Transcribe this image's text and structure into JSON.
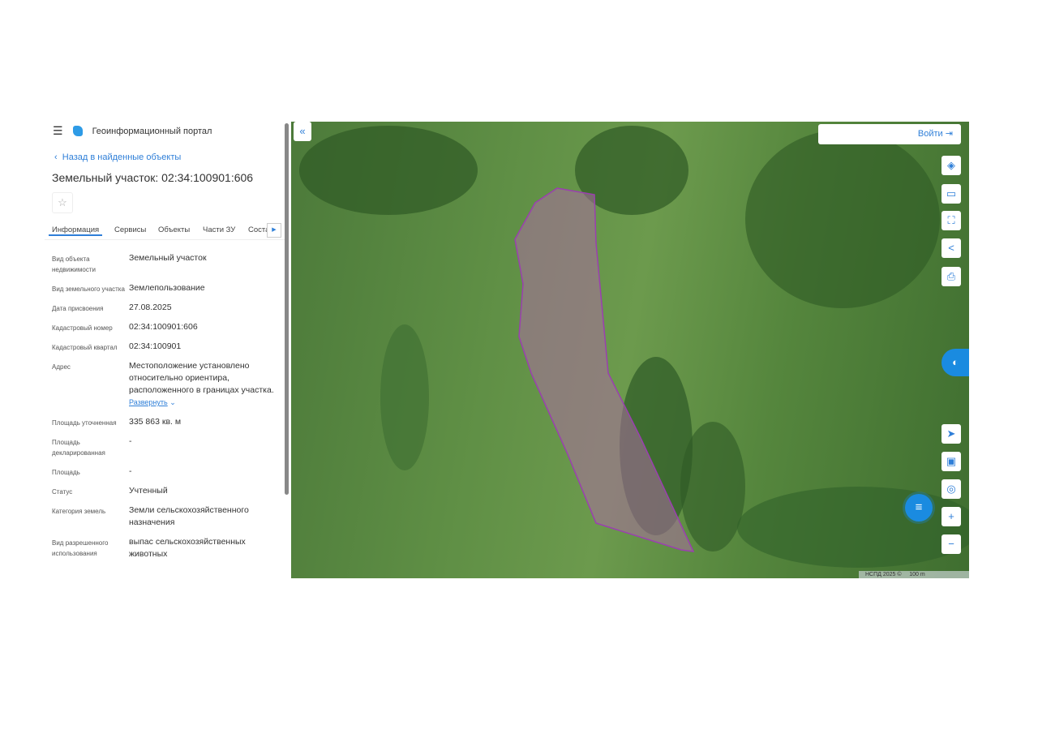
{
  "header": {
    "app_title": "Геоинформационный портал",
    "back_link": "Назад в найденные объекты",
    "object_title": "Земельный участок: 02:34:100901:606"
  },
  "tabs": [
    "Информация",
    "Сервисы",
    "Объекты",
    "Части ЗУ",
    "Соста"
  ],
  "fields": [
    {
      "label": "Вид объекта недвижимости",
      "value": "Земельный участок"
    },
    {
      "label": "Вид земельного участка",
      "value": "Землепользование"
    },
    {
      "label": "Дата присвоения",
      "value": "27.08.2025"
    },
    {
      "label": "Кадастровый номер",
      "value": "02:34:100901:606"
    },
    {
      "label": "Кадастровый квартал",
      "value": "02:34:100901"
    },
    {
      "label": "Адрес",
      "value": "Местоположение установлено относительно ориентира, расположенного в границах участка.",
      "link": "Развернуть"
    },
    {
      "label": "Площадь уточненная",
      "value": "335 863 кв. м"
    },
    {
      "label": "Площадь декларированная",
      "value": "-"
    },
    {
      "label": "Площадь",
      "value": "-"
    },
    {
      "label": "Статус",
      "value": "Учтенный"
    },
    {
      "label": "Категория земель",
      "value": "Земли сельскохозяйственного назначения"
    },
    {
      "label": "Вид разрешенного использования",
      "value": "выпас сельскохозяйственных животных"
    }
  ],
  "map": {
    "login_label": "Войти",
    "attribution": "НСПД 2025 ©",
    "scale": "100 m",
    "parcel_color": "#9b3fb0"
  }
}
